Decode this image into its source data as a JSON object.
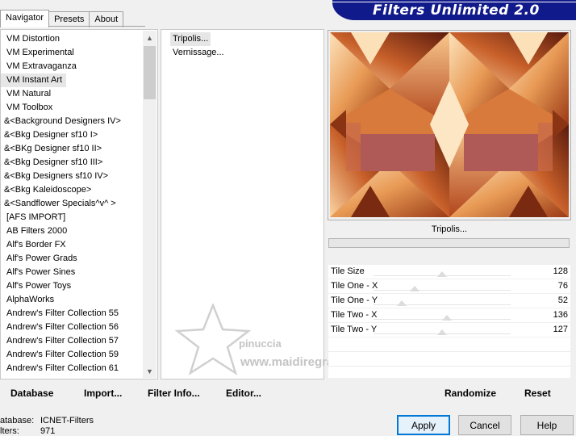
{
  "tabs": [
    {
      "label": "Navigator",
      "active": true
    },
    {
      "label": "Presets",
      "active": false
    },
    {
      "label": "About",
      "active": false
    }
  ],
  "banner": {
    "title": "Filters Unlimited 2.0",
    "color": "#101a8a"
  },
  "categories": {
    "selected": "VM Instant Art",
    "items": [
      "VM Distortion",
      "VM Experimental",
      "VM Extravaganza",
      "VM Instant Art",
      "VM Natural",
      "VM Toolbox",
      "&<Background Designers IV>",
      "&<Bkg Designer sf10 I>",
      "&<BKg Designer sf10 II>",
      "&<Bkg Designer sf10 III>",
      "&<Bkg Designers sf10 IV>",
      "&<Bkg Kaleidoscope>",
      "&<Sandflower Specials^v^ >",
      "[AFS IMPORT]",
      "AB Filters 2000",
      "Alf's Border FX",
      "Alf's Power Grads",
      "Alf's Power Sines",
      "Alf's Power Toys",
      "AlphaWorks",
      "Andrew's Filter Collection 55",
      "Andrew's Filter Collection 56",
      "Andrew's Filter Collection 57",
      "Andrew's Filter Collection 59",
      "Andrew's Filter Collection 61"
    ]
  },
  "filters": {
    "selected": "Tripolis...",
    "items": [
      "Tripolis...",
      "Vernissage..."
    ]
  },
  "preview": {
    "filter_name": "Tripolis..."
  },
  "parameters": [
    {
      "label": "Tile Size",
      "value": "128",
      "level": 128
    },
    {
      "label": "Tile One - X",
      "value": "76",
      "level": 76
    },
    {
      "label": "Tile One - Y",
      "value": "52",
      "level": 52
    },
    {
      "label": "Tile Two - X",
      "value": "136",
      "level": 136
    },
    {
      "label": "Tile Two - Y",
      "value": "127",
      "level": 127
    }
  ],
  "watermark": {
    "text1": "pinuccia",
    "text2": "www.maidiregrafica.eu"
  },
  "toolbar": {
    "database": "Database",
    "import": "Import...",
    "filter_info": "Filter Info...",
    "editor": "Editor...",
    "randomize": "Randomize",
    "reset": "Reset"
  },
  "status": {
    "database_label": "atabase:",
    "database_value": "ICNET-Filters",
    "filters_label": "lters:",
    "filters_value": "971"
  },
  "dialog": {
    "apply": "Apply",
    "cancel": "Cancel",
    "help": "Help"
  }
}
